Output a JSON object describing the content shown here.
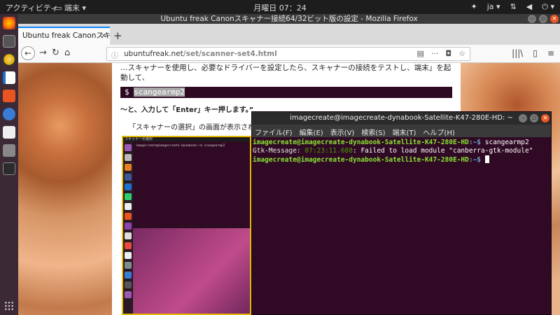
{
  "top_panel": {
    "activities": "アクティビティ",
    "app_menu": "端末",
    "clock": "月曜日 07：24",
    "language": "ja"
  },
  "launcher": {
    "icons": [
      "firefox-icon",
      "files-icon",
      "rhythmbox-icon",
      "writer-icon",
      "software-center-icon",
      "help-icon",
      "amazon-icon",
      "screenshot-icon",
      "terminal-icon"
    ]
  },
  "firefox": {
    "title": "Ubuntu freak Canonスキャナー接続64/32ビット版の設定 - Mozilla Firefox",
    "tab_label": "Ubuntu freak Canonスキャ…",
    "url_domain": "ubuntufreak.net",
    "url_path": "/set/scanner-set4.html"
  },
  "article": {
    "intro": "…スキャナーを使用し、必要なドライバーを設定したら、スキャナーの接続をテストし、端末」を起動して、",
    "command_prefix": "$",
    "command": "scangearmp2",
    "para1": "～と、入力して「Enter」キー押します。”",
    "para2": "「スキャナーの選択」の画面が表示されたら、「OK」をクリックします。",
    "screenshot_title": "スキャナーの選択",
    "screenshot_cmd": "imagecreate@imagecreate-dynabook:~$ scangearmp2"
  },
  "terminal": {
    "title": "imagecreate@imagecreate-dynabook-Satellite-K47-280E-HD: ~",
    "menu": [
      "ファイル(F)",
      "編集(E)",
      "表示(V)",
      "検索(S)",
      "端末(T)",
      "ヘルプ(H)"
    ],
    "prompt_user": "imagecreate@imagecreate-dynabook-Satellite-K47-280E-HD",
    "prompt_path": ":~$",
    "line1_cmd": " scangearmp2",
    "warn_key": "Gtk-Message:",
    "warn_time": " 07:23:11.688",
    "warn_msg": ": Failed to load module \"canberra-gtk-module\""
  }
}
